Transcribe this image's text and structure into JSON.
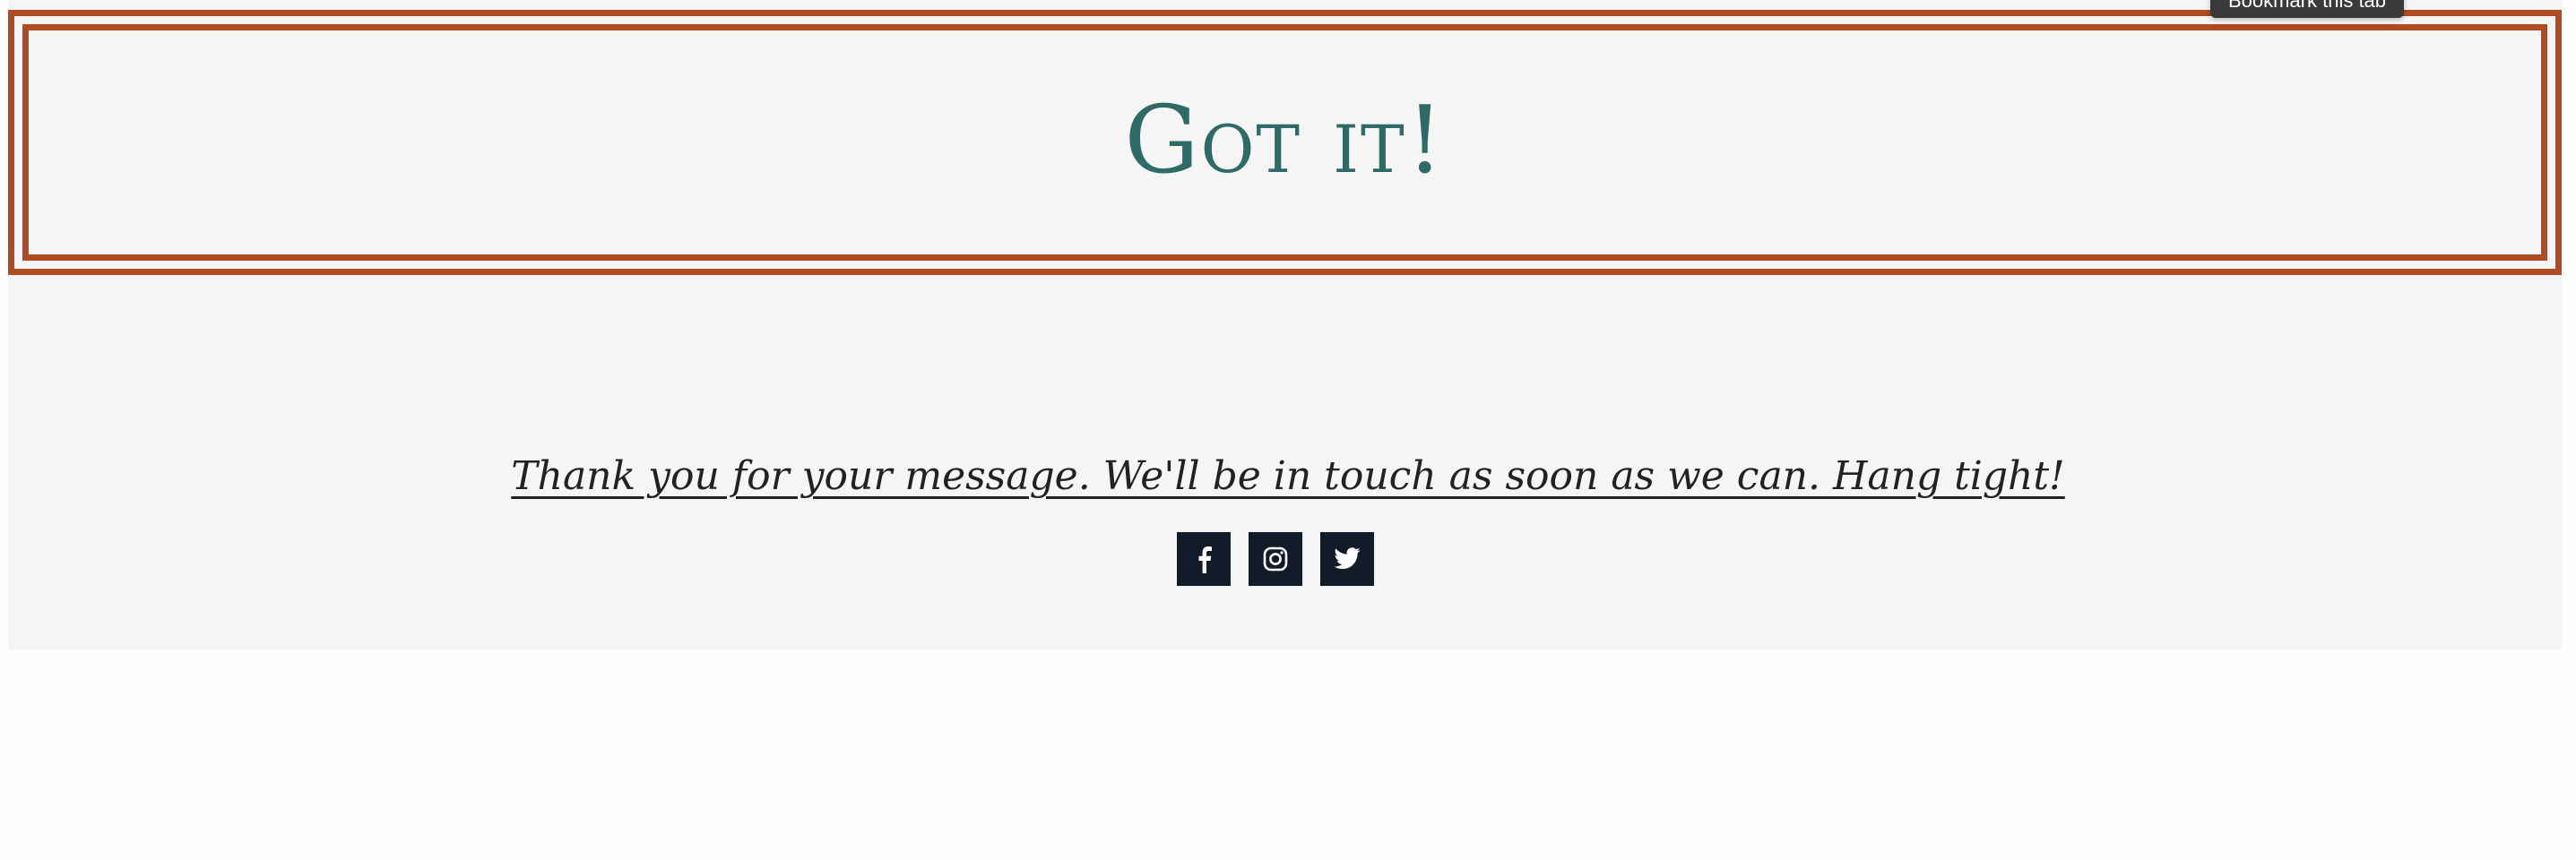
{
  "header": {
    "title": "Got it!"
  },
  "tooltip": {
    "text": "Bookmark this tab"
  },
  "message": {
    "text": "Thank you for your message. We'll be in touch as soon as we can. Hang tight!"
  },
  "social": {
    "items": [
      {
        "icon": "facebook-icon"
      },
      {
        "icon": "instagram-icon"
      },
      {
        "icon": "twitter-icon"
      }
    ]
  },
  "colors": {
    "frame_border": "#b04a22",
    "title_text": "#2f6b66",
    "section_bg": "#f5f5f5",
    "social_bg": "#111b29"
  }
}
